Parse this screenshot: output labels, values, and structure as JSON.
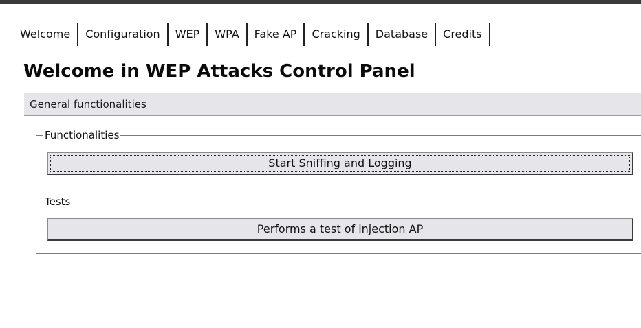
{
  "tabs": [
    {
      "label": "Welcome"
    },
    {
      "label": "Configuration"
    },
    {
      "label": "WEP"
    },
    {
      "label": "WPA"
    },
    {
      "label": "Fake AP"
    },
    {
      "label": "Cracking"
    },
    {
      "label": "Database"
    },
    {
      "label": "Credits"
    }
  ],
  "active_tab": "WEP",
  "page": {
    "title": "Welcome in WEP Attacks Control Panel",
    "section_header": "General functionalities"
  },
  "groups": {
    "functionalities": {
      "legend": "Functionalities",
      "button_label": "Start Sniffing and Logging"
    },
    "tests": {
      "legend": "Tests",
      "button_label": "Performs a test of injection AP"
    }
  }
}
